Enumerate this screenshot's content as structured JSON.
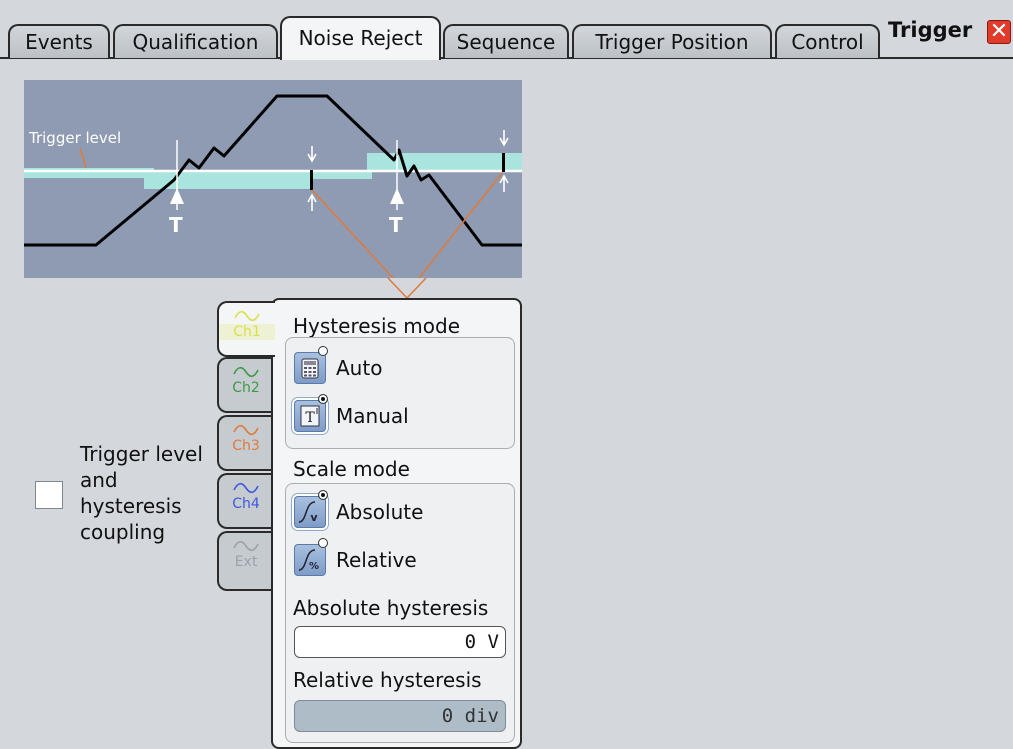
{
  "tabs": [
    {
      "label": "Events"
    },
    {
      "label": "Qualification"
    },
    {
      "label": "Noise Reject",
      "active": true
    },
    {
      "label": "Sequence"
    },
    {
      "label": "Trigger Position"
    },
    {
      "label": "Control"
    }
  ],
  "window": {
    "title": "Trigger",
    "close_glyph": "✕"
  },
  "diagram": {
    "trigger_level_label": "Trigger level",
    "marker_glyph": "T"
  },
  "coupling": {
    "label": "Trigger level and hysteresis coupling",
    "checked": false
  },
  "channels": [
    {
      "label": "Ch1",
      "color": "#d8e04a",
      "active": true
    },
    {
      "label": "Ch2",
      "color": "#3e9a48"
    },
    {
      "label": "Ch3",
      "color": "#e07a3a"
    },
    {
      "label": "Ch4",
      "color": "#3e58e0"
    },
    {
      "label": "Ext",
      "color": "#9aa2aa"
    }
  ],
  "hysteresis_mode": {
    "title": "Hysteresis mode",
    "options": [
      {
        "label": "Auto",
        "icon": "calculator-icon",
        "selected": false
      },
      {
        "label": "Manual",
        "icon": "manual-t-icon",
        "selected": true
      }
    ]
  },
  "scale_mode": {
    "title": "Scale mode",
    "options": [
      {
        "label": "Absolute",
        "icon": "absolute-scale-icon",
        "selected": true
      },
      {
        "label": "Relative",
        "icon": "relative-scale-icon",
        "selected": false
      }
    ]
  },
  "absolute_hysteresis": {
    "label": "Absolute hysteresis",
    "value": "0 V"
  },
  "relative_hysteresis": {
    "label": "Relative hysteresis",
    "value": "0 div",
    "disabled": true
  }
}
